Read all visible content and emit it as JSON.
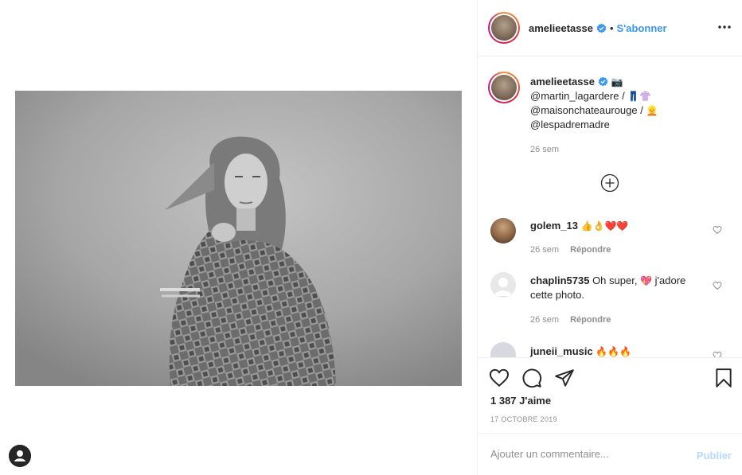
{
  "post": {
    "author": "amelieetasse",
    "follow_label": "S'abonner",
    "separator": "•"
  },
  "caption": {
    "username": "amelieetasse",
    "line1_emoji": "📷",
    "line2_text": "@martin_lagardere /",
    "line2_emoji": "👖👚",
    "line3_text": "@maisonchateaurouge /",
    "line3_emoji": "👱",
    "line4_text": "@lespadremadre",
    "time": "26 sem"
  },
  "comments": [
    {
      "username": "golem_13",
      "text": "",
      "emoji": "👍👌❤️❤️",
      "time": "26 sem",
      "reply_label": "Répondre"
    },
    {
      "username": "chaplin5735",
      "text": "Oh super,",
      "emoji": "💖",
      "text2": "j'adore",
      "text3": "cette photo.",
      "time": "26 sem",
      "reply_label": "Répondre"
    },
    {
      "username": "juneii_music",
      "text": "",
      "emoji": "🔥🔥🔥"
    }
  ],
  "stats": {
    "likes": "1 387 J'aime",
    "date": "17 OCTOBRE 2019"
  },
  "add_comment": {
    "placeholder": "Ajouter un commentaire...",
    "publish_label": "Publier"
  },
  "colors": {
    "link_blue": "#3897f0",
    "publish_disabled": "#b3dbff",
    "muted": "#8e8e8e",
    "text": "#262626"
  },
  "icons": [
    "verified-badge-icon",
    "more-options-icon",
    "add-circle-icon",
    "heart-icon",
    "comment-icon",
    "share-icon",
    "bookmark-icon",
    "user-account-icon"
  ]
}
